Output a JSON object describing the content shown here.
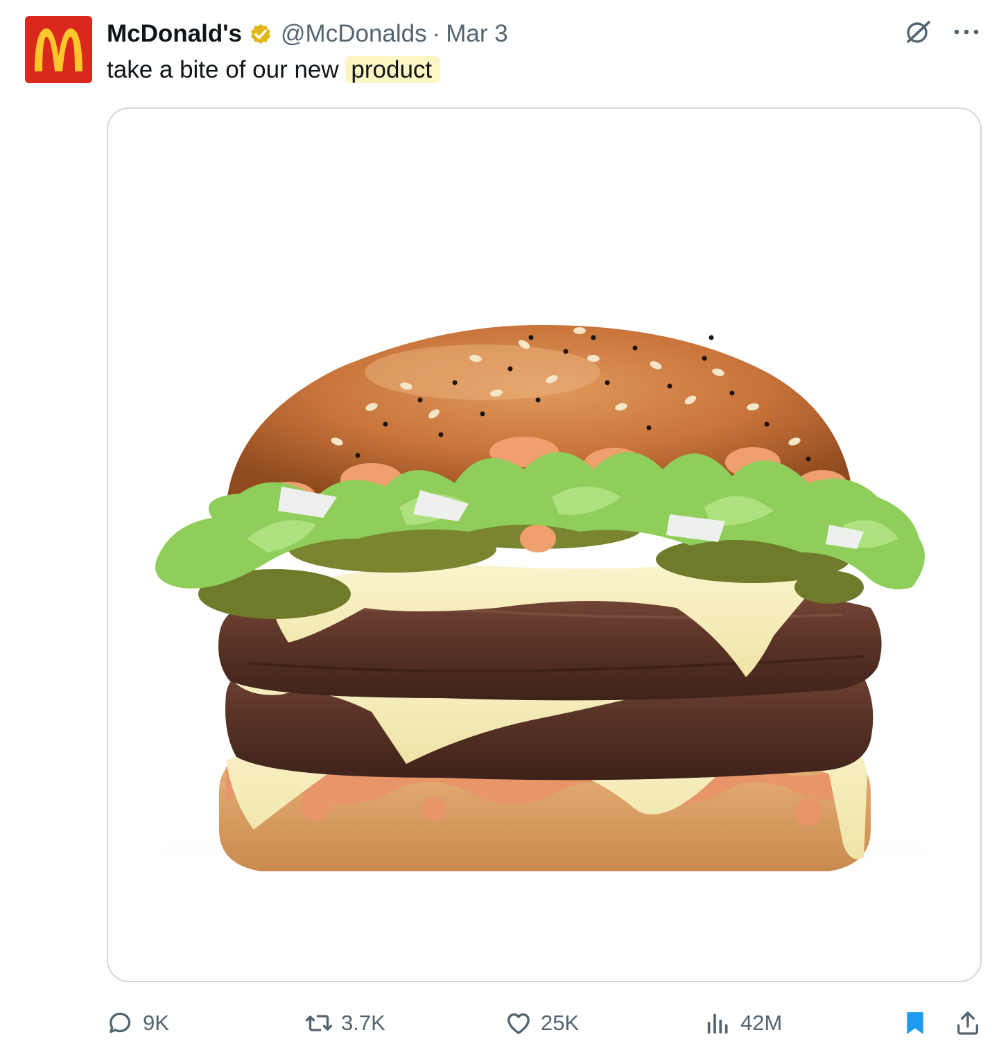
{
  "tweet": {
    "author": {
      "name": "McDonald's",
      "handle": "@McDonalds",
      "verified": true,
      "avatar_icon": "mcdonalds-golden-arches-logo"
    },
    "separator": "·",
    "date": "Mar 3",
    "text_plain": "take a bite of our new",
    "text_highlighted": "product",
    "media": {
      "kind": "product-photo",
      "subject_icon": "burger-photo"
    },
    "metrics": {
      "replies": "9K",
      "reposts": "3.7K",
      "likes": "25K",
      "views": "42M"
    },
    "bookmarked": true
  },
  "colors": {
    "brand_red": "#da291c",
    "brand_yellow": "#ffc72c",
    "verified_gold": "#e2b719",
    "secondary_text": "#536471",
    "bookmark_blue": "#1d9bf0",
    "highlight": "#fdf5c4"
  },
  "icons": {
    "top_right": [
      "grok-icon",
      "more-icon"
    ],
    "actions": [
      "reply-icon",
      "repost-icon",
      "like-icon",
      "views-icon",
      "bookmark-icon",
      "share-icon"
    ]
  }
}
